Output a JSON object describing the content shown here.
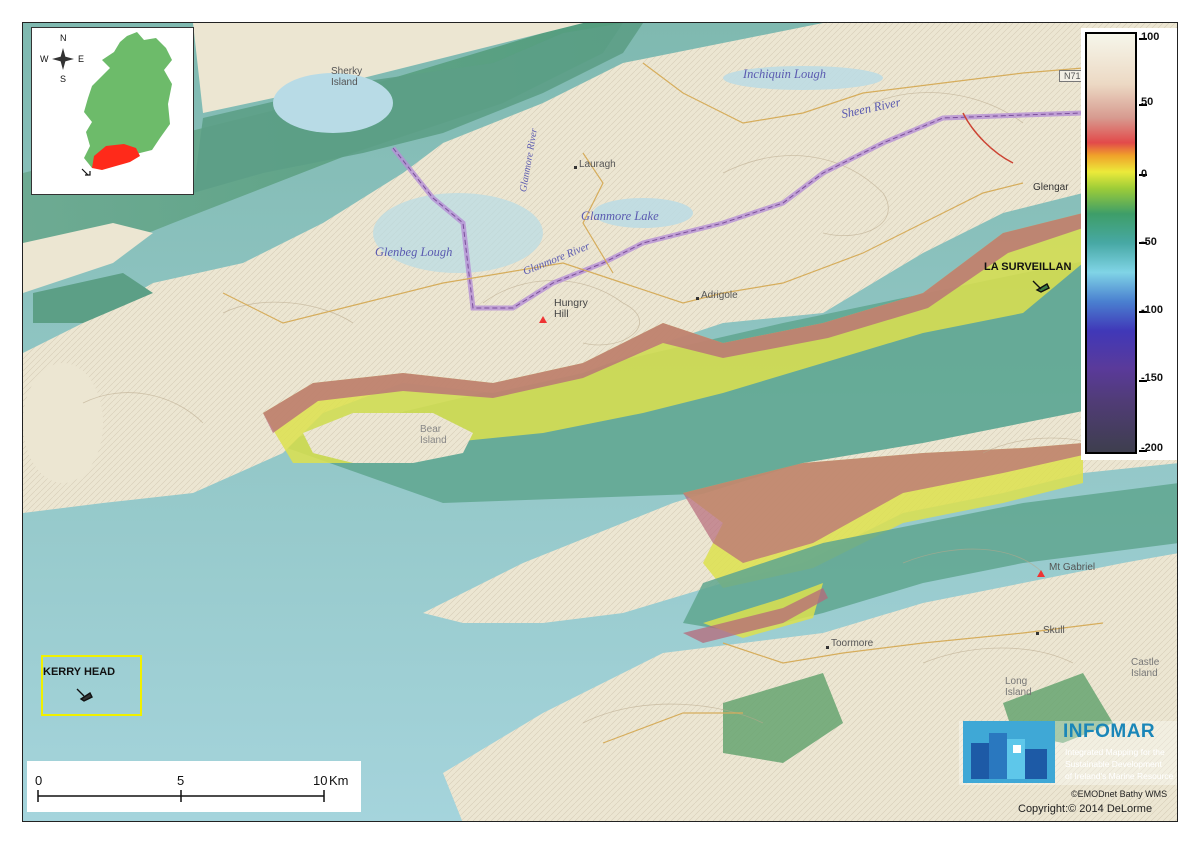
{
  "map": {
    "places": [
      {
        "key": "sherky",
        "name": "Sherky\nIsland"
      },
      {
        "key": "lauragh",
        "name": "Lauragh"
      },
      {
        "key": "hungry_hill",
        "name": "Hungry\nHill"
      },
      {
        "key": "adrigole",
        "name": "Adrigole"
      },
      {
        "key": "bear",
        "name": "Bear\nIsland"
      },
      {
        "key": "mt_gabriel",
        "name": "Mt Gabriel"
      },
      {
        "key": "toormore",
        "name": "Toormore"
      },
      {
        "key": "skull",
        "name": "Skull"
      },
      {
        "key": "castle",
        "name": "Castle\nIsland"
      },
      {
        "key": "long",
        "name": "Long\nIsland"
      },
      {
        "key": "glengarriff",
        "name": "Glengar"
      }
    ],
    "water_labels": [
      {
        "key": "inchiquin",
        "name": "Inchiquin Lough"
      },
      {
        "key": "sheen",
        "name": "Sheen River"
      },
      {
        "key": "glanmore_lake",
        "name": "Glanmore Lake"
      },
      {
        "key": "glenbeg",
        "name": "Glenbeg Lough"
      },
      {
        "key": "glanmore_r1",
        "name": "Glanmore River"
      },
      {
        "key": "glanmore_r2",
        "name": "Glanmore River"
      }
    ],
    "road": "N71"
  },
  "legend": {
    "ticks": [
      "100",
      "50",
      "0",
      "-50",
      "-100",
      "-150",
      "-200"
    ],
    "colors": {
      "top": "#f6f6ea",
      "red": "#e24a4a",
      "yellow": "#ecea3a",
      "green": "#3e9e68",
      "cyan": "#80d4e6",
      "blue": "#4038b8",
      "bottom": "#3e3e4e"
    }
  },
  "inset": {
    "compass": {
      "n": "N",
      "s": "S",
      "e": "E",
      "w": "W"
    },
    "land_color": "#6dbb6a",
    "highlight_color": "#ff2a1a"
  },
  "wrecks": {
    "kerry_head": "KERRY HEAD",
    "la_surveillante": "LA SURVEILLAN"
  },
  "scale": {
    "labels": [
      "0",
      "5",
      "10"
    ],
    "unit": "Km"
  },
  "branding": {
    "title": "INFOMAR",
    "lines": [
      "Integrated Mapping for the",
      "Sustainable Development",
      "of Ireland's Marine Resource"
    ],
    "credit_emodnet": "©EMODnet Bathy WMS",
    "copyright": "Copyright:© 2014 DeLorme"
  }
}
